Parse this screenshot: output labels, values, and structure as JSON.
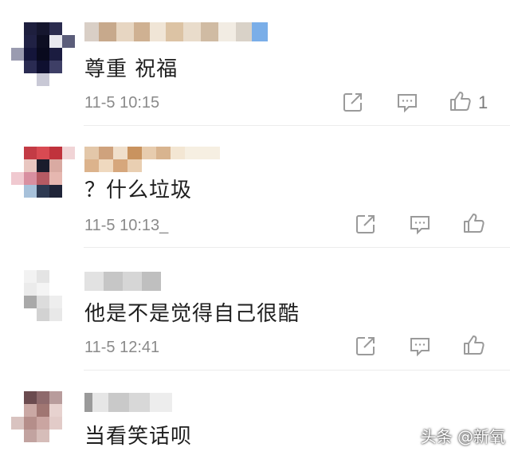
{
  "comments": [
    {
      "text": "尊重 祝福",
      "time": "11-5 10:15",
      "likes": "1"
    },
    {
      "text": "？什么垃圾",
      "time": "11-5 10:13_"
    },
    {
      "text": "他是不是觉得自己很酷",
      "time": "11-5 12:41"
    },
    {
      "text": "当看笑话呗"
    }
  ],
  "icons": {
    "share": "share-icon",
    "reply": "reply-icon",
    "like": "thumbs-up-icon"
  },
  "watermark": "头条 @新氧",
  "colors": {
    "text": "#1f1f1f",
    "meta": "#8a8a8a",
    "icon": "#9a9a9a"
  }
}
